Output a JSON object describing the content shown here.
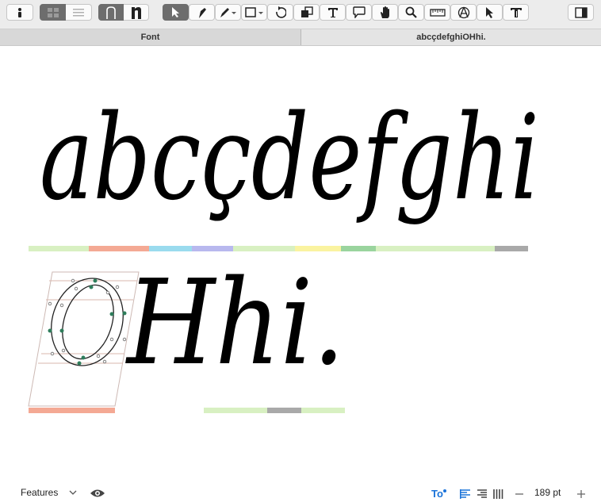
{
  "toolbar": {
    "buttons": [
      "info-icon",
      "grid-view-icon",
      "list-view-icon",
      "outline-preview-icon",
      "filled-preview-icon",
      "select-tool-icon",
      "pen-tool-icon",
      "pencil-tool-icon",
      "rectangle-tool-icon",
      "rotate-tool-icon",
      "scale-tool-icon",
      "text-tool-icon",
      "annotation-tool-icon",
      "hand-tool-icon",
      "zoom-tool-icon",
      "measure-tool-icon",
      "anchor-tool-icon",
      "select-all-tool-icon",
      "type-size-tool-icon",
      "sidebar-toggle-icon"
    ]
  },
  "tabs": [
    {
      "label": "Font",
      "active": true
    },
    {
      "label": "abcçdefghiOHhi.",
      "active": false
    }
  ],
  "canvas": {
    "line1": "abcçdefghi",
    "line2_glyphs": "Hhi.",
    "selected_glyph": "O",
    "colors": {
      "text": "#000000",
      "outline": "#222222",
      "node": "#2e7d5b",
      "metrics": "#cfa8a0"
    }
  },
  "statusbar": {
    "features_label": "Features",
    "font_size": "189 pt",
    "accent": "#1a73d9"
  }
}
